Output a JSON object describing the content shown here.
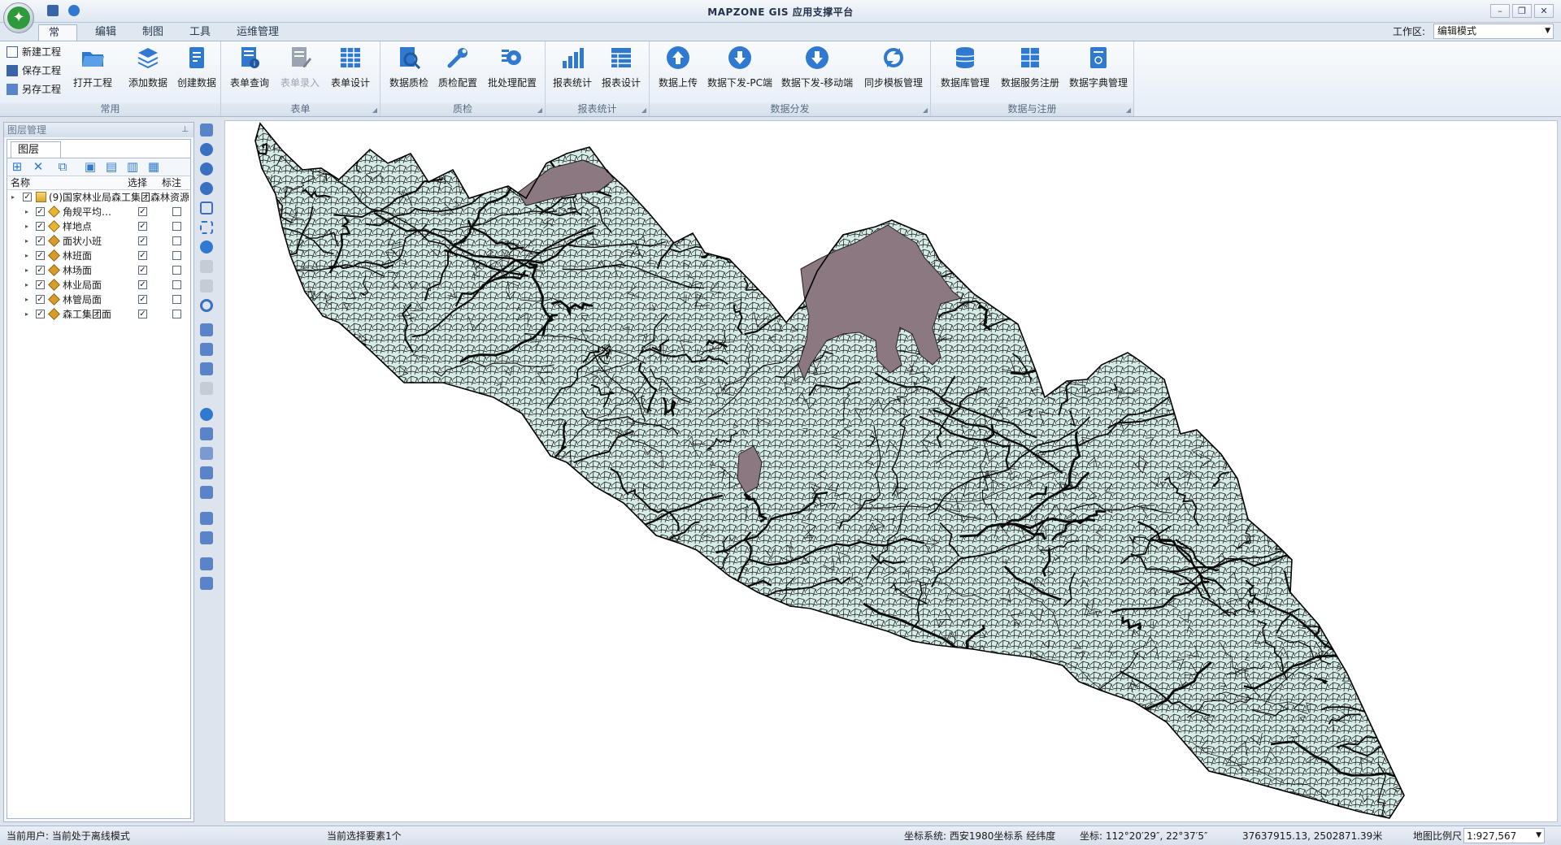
{
  "app": {
    "title": "MAPZONE GIS 应用支撑平台",
    "win_minimize": "–",
    "win_restore": "❐",
    "win_close": "✕"
  },
  "tabs": [
    "常用",
    "编辑",
    "制图",
    "工具",
    "运维管理"
  ],
  "workspace": {
    "label": "工作区:",
    "value": "编辑模式"
  },
  "ribbon": {
    "project": {
      "new": "新建工程",
      "save": "保存工程",
      "save_as": "另存工程",
      "open": "打开工程"
    },
    "data": {
      "add": "添加数据",
      "create": "创建数据"
    },
    "group_common": "常用",
    "form": {
      "query": "表单查询",
      "entry": "表单录入",
      "design": "表单设计",
      "group": "表单"
    },
    "qc": {
      "check": "数据质检",
      "config": "质检配置",
      "batch": "批处理配置",
      "group": "质检"
    },
    "report": {
      "stats": "报表统计",
      "design": "报表设计",
      "group": "报表统计"
    },
    "distribute": {
      "upload": "数据上传",
      "down_pc": "数据下发-PC端",
      "down_mobile": "数据下发-移动端",
      "sync": "同步模板管理",
      "group": "数据分发"
    },
    "register": {
      "db": "数据库管理",
      "service": "数据服务注册",
      "dict": "数据字典管理",
      "group": "数据与注册"
    }
  },
  "layer_panel": {
    "title": "图层管理",
    "tab": "图层",
    "columns": {
      "name": "名称",
      "select": "选择",
      "label": "标注"
    },
    "root": "(9)国家林业局森工集团森林资源",
    "layers": [
      {
        "name": "角规平均…",
        "visible": true,
        "select": true,
        "label": false
      },
      {
        "name": "样地点",
        "visible": true,
        "select": true,
        "label": false
      },
      {
        "name": "面状小班",
        "visible": true,
        "select": true,
        "label": false
      },
      {
        "name": "林班面",
        "visible": true,
        "select": true,
        "label": false
      },
      {
        "name": "林场面",
        "visible": true,
        "select": true,
        "label": false
      },
      {
        "name": "林业局面",
        "visible": true,
        "select": true,
        "label": false
      },
      {
        "name": "林管局面",
        "visible": true,
        "select": true,
        "label": false
      },
      {
        "name": "森工集团面",
        "visible": true,
        "select": true,
        "label": false
      }
    ]
  },
  "status": {
    "user": "当前用户:  当前处于离线模式",
    "selection": "当前选择要素1个",
    "crs": "坐标系统: 西安1980坐标系 经纬度",
    "coord": "坐标:  112°20′29″, 22°37′5″",
    "projected": "37637915.13, 2502871.39米",
    "scale_label": "地图比例尺",
    "scale": "1:927,567"
  },
  "colors": {
    "map_fill": "#d6ece6",
    "map_outline": "#101010",
    "highlight_fill": "#8c7880",
    "accent": "#2e6fb6"
  }
}
